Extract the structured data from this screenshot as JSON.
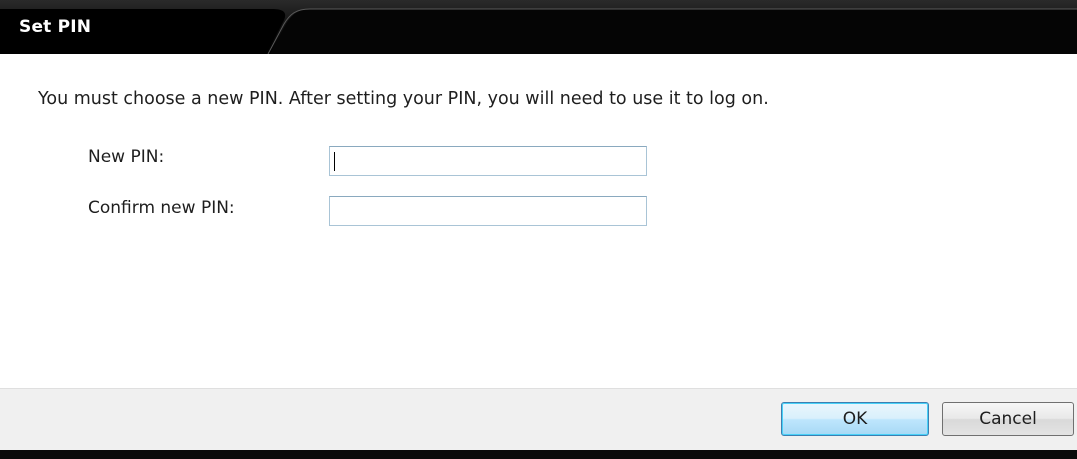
{
  "window": {
    "title": "Set PIN"
  },
  "main": {
    "message": "You must choose a new PIN. After setting your PIN, you will need to use it to log on.",
    "fields": [
      {
        "label": "New PIN:",
        "value": "",
        "placeholder": ""
      },
      {
        "label": "Confirm new PIN:",
        "value": "",
        "placeholder": ""
      }
    ]
  },
  "footer": {
    "ok_label": "OK",
    "cancel_label": "Cancel"
  },
  "colors": {
    "titlebar": "#000000",
    "title_text": "#ffffff",
    "footer_bg": "#f0f0f0",
    "input_border": "#a9c4d6",
    "default_button_border": "#3c7fb1"
  }
}
